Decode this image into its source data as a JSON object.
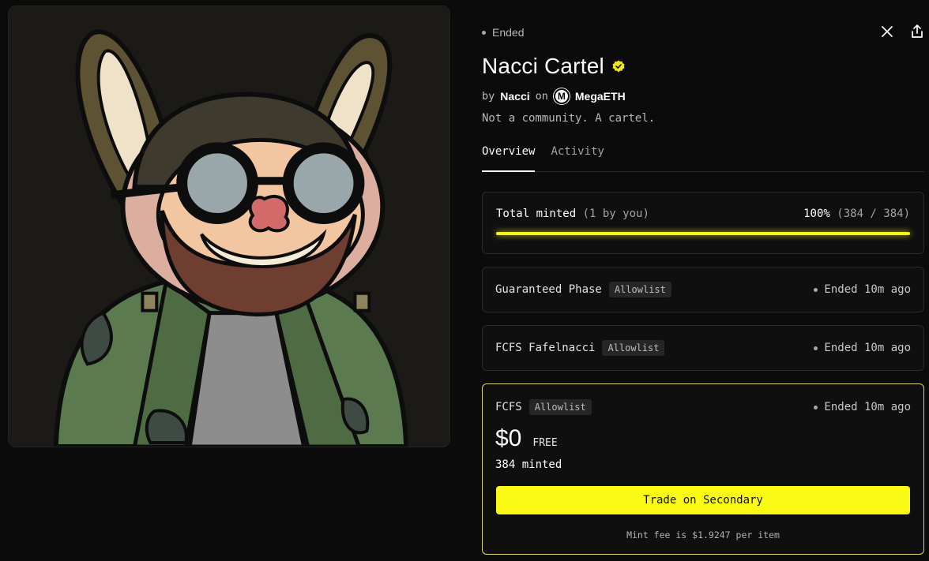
{
  "artwork": {
    "icon": "nft-artwork-bunny-character"
  },
  "status": {
    "label": "Ended"
  },
  "actions": {
    "x_icon": "x-logo-icon",
    "share_icon": "share-icon"
  },
  "collection": {
    "name": "Nacci Cartel",
    "by_prefix": "by",
    "creator": "Nacci",
    "on_text": "on",
    "chain": "MegaETH",
    "chain_logo_letter": "M",
    "description": "Not a community. A cartel."
  },
  "tabs": [
    {
      "label": "Overview",
      "active": true
    },
    {
      "label": "Activity",
      "active": false
    }
  ],
  "total": {
    "label": "Total minted",
    "by_you": "(1 by you)",
    "percent_text": "100%",
    "counts": "(384 / 384)",
    "progress": 1.0
  },
  "phases": [
    {
      "name": "Guaranteed Phase",
      "badge": "Allowlist",
      "status": "Ended 10m ago"
    },
    {
      "name": "FCFS Fafelnacci",
      "badge": "Allowlist",
      "status": "Ended 10m ago"
    },
    {
      "name": "FCFS",
      "badge": "Allowlist",
      "status": "Ended 10m ago"
    }
  ],
  "active_phase": {
    "price": "$0",
    "price_note": "FREE",
    "minted": "384 minted",
    "button": "Trade on Secondary",
    "fee": "Mint fee is $1.9247 per item"
  },
  "colors": {
    "accent": "#f5f21f",
    "background": "#0b0b0b",
    "verified": "#f0e61a"
  }
}
